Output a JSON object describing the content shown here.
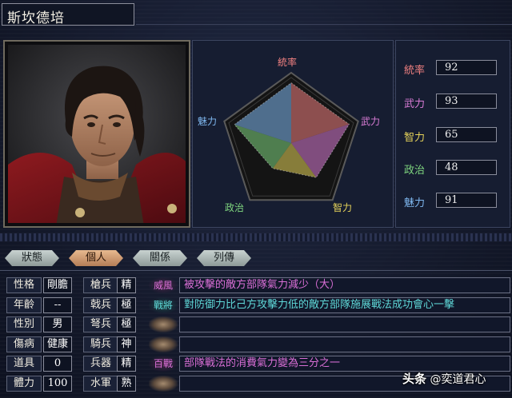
{
  "title": "斯坎德培",
  "radar": {
    "labels": {
      "top": "統率",
      "right": "武力",
      "bottom_right": "智力",
      "bottom_left": "政治",
      "left": "魅力"
    },
    "label_colors": {
      "top": "#f08080",
      "right": "#d97cd6",
      "bottom_right": "#e6d35a",
      "bottom_left": "#7fd67f",
      "left": "#7fb8f0"
    }
  },
  "stats": [
    {
      "label": "統率",
      "value": "92",
      "color": "#f08080",
      "fraction": 0.92
    },
    {
      "label": "武力",
      "value": "93",
      "color": "#d97cd6",
      "fraction": 0.93
    },
    {
      "label": "智力",
      "value": "65",
      "color": "#e6d35a",
      "fraction": 0.65
    },
    {
      "label": "政治",
      "value": "48",
      "color": "#7fd67f",
      "fraction": 0.48
    },
    {
      "label": "魅力",
      "value": "91",
      "color": "#7fb8f0",
      "fraction": 0.91
    }
  ],
  "tabs": [
    "狀態",
    "個人",
    "關係",
    "列傳"
  ],
  "active_tab": "個人",
  "attributes_left": [
    {
      "label": "性格",
      "value": "剛膽"
    },
    {
      "label": "年齡",
      "value": "--"
    },
    {
      "label": "性別",
      "value": "男"
    },
    {
      "label": "傷病",
      "value": "健康"
    },
    {
      "label": "道具",
      "value": "0"
    },
    {
      "label": "體力",
      "value": "100"
    }
  ],
  "attributes_right": [
    {
      "label": "槍兵",
      "value": "精"
    },
    {
      "label": "戟兵",
      "value": "極"
    },
    {
      "label": "弩兵",
      "value": "極"
    },
    {
      "label": "騎兵",
      "value": "神"
    },
    {
      "label": "兵器",
      "value": "精"
    },
    {
      "label": "水軍",
      "value": "熟"
    }
  ],
  "skills": [
    {
      "name": "威風",
      "color": "#d96fd6",
      "desc": "被攻擊的敵方部隊氣力減少（大）"
    },
    {
      "name": "戰將",
      "color": "#5fd8d8",
      "desc": "對防御力比己方攻擊力低的敵方部隊施展戰法成功會心一擊"
    },
    {
      "name": "",
      "color": "",
      "desc": ""
    },
    {
      "name": "",
      "color": "",
      "desc": ""
    },
    {
      "name": "百戰",
      "color": "#d96fd6",
      "desc": "部隊戰法的消費氣力變為三分之一"
    },
    {
      "name": "",
      "color": "",
      "desc": ""
    }
  ],
  "watermark": {
    "prefix": "头条",
    "text": "@奕道君心"
  }
}
